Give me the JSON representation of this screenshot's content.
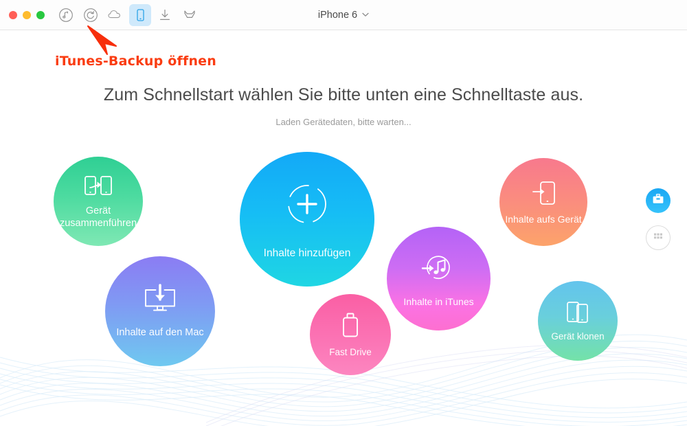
{
  "window": {
    "traffic_lights": [
      {
        "name": "close",
        "color": "#ff5f57"
      },
      {
        "name": "minimize",
        "color": "#febc2e"
      },
      {
        "name": "maximize",
        "color": "#28c840"
      }
    ],
    "device_title": "iPhone 6",
    "device_chevron": "⌄"
  },
  "toolbar": {
    "items": [
      {
        "icon": "music-note-circle-icon",
        "label": "Musik",
        "selected": false
      },
      {
        "icon": "backup-restore-circle-icon",
        "label": "iTunes-Backup",
        "selected": false
      },
      {
        "icon": "cloud-icon",
        "label": "iCloud",
        "selected": false
      },
      {
        "icon": "phone-icon",
        "label": "Gerät",
        "selected": true
      },
      {
        "icon": "download-icon",
        "label": "Download",
        "selected": false
      },
      {
        "icon": "toolbox-outline-icon",
        "label": "Werkzeuge",
        "selected": false
      }
    ]
  },
  "annotation": {
    "text": "iTunes-Backup öffnen",
    "color": "#fa3c11",
    "arrow": "red-arrow-up-left"
  },
  "main": {
    "headline": "Zum Schnellstart wählen Sie bitte unten eine Schnelltaste aus.",
    "subline": "Laden Gerätedaten, bitte warten..."
  },
  "bubbles": [
    {
      "id": "merge",
      "label": "Gerät\nzusammenführen",
      "label_line1": "Gerät",
      "label_line2": "zusammenführen",
      "icon": "two-phones-arrow-icon",
      "color_from": "#2fcf94",
      "color_to": "#7fe8b4"
    },
    {
      "id": "add",
      "label": "Inhalte hinzufügen",
      "icon": "dashed-circle-plus-icon",
      "color_from": "#13a9f7",
      "color_to": "#1fd6e3"
    },
    {
      "id": "to-device",
      "label": "Inhalte aufs Gerät",
      "icon": "phone-arrow-in-icon",
      "color_from": "#f8798d",
      "color_to": "#fca36a"
    },
    {
      "id": "to-mac",
      "label": "Inhalte auf den Mac",
      "icon": "monitor-download-icon",
      "color_from": "#8b7cf3",
      "color_to": "#6fc9f0"
    },
    {
      "id": "to-itunes",
      "label": "Inhalte in iTunes",
      "icon": "music-note-arrow-circle-icon",
      "color_from": "#b463f6",
      "color_to": "#fd6fd0"
    },
    {
      "id": "fast-drive",
      "label": "Fast Drive",
      "icon": "usb-drive-icon",
      "color_from": "#fa5fa4",
      "color_to": "#fc86c0"
    },
    {
      "id": "clone",
      "label": "Gerät klonen",
      "icon": "two-phones-icon",
      "color_from": "#63c4ed",
      "color_to": "#74e2a8"
    }
  ],
  "side_buttons": [
    {
      "id": "toolbox",
      "icon": "toolbox-icon",
      "accent": "#1aa7f3"
    },
    {
      "id": "grid",
      "icon": "grid-apps-icon",
      "accent": "#c9c9c9"
    }
  ]
}
